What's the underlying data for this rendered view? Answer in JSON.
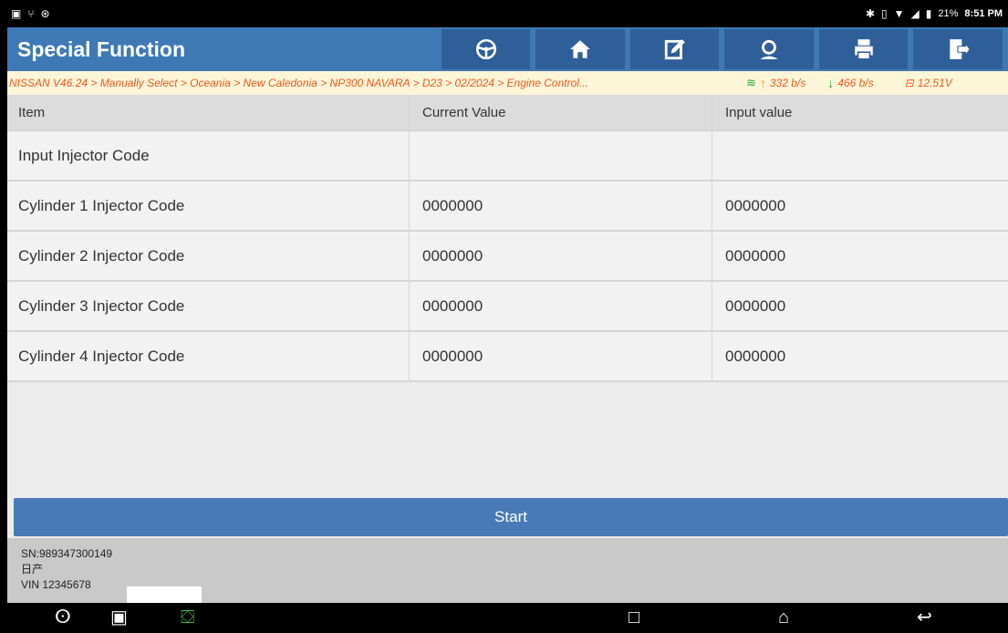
{
  "status_bar": {
    "battery_percent": "21%",
    "time": "8:51 PM"
  },
  "header": {
    "title": "Special Function",
    "buttons": [
      {
        "icon": "steering-wheel-icon"
      },
      {
        "icon": "home-icon"
      },
      {
        "icon": "edit-report-icon"
      },
      {
        "icon": "user-support-icon"
      },
      {
        "icon": "printer-icon"
      },
      {
        "icon": "exit-icon"
      }
    ]
  },
  "breadcrumb": {
    "path": "NISSAN V46.24 > Manually Select > Oceania > New Caledonia > NP300 NAVARA > D23 > 02/2024 > Engine Control...",
    "upload_speed": "332 b/s",
    "download_speed": "466 b/s",
    "voltage": "12.51V"
  },
  "table": {
    "headers": [
      "Item",
      "Current Value",
      "Input value"
    ],
    "rows": [
      {
        "item": "Input Injector Code",
        "current": "",
        "input": ""
      },
      {
        "item": "Cylinder 1 Injector Code",
        "current": "0000000",
        "input": "0000000"
      },
      {
        "item": "Cylinder 2 Injector Code",
        "current": "0000000",
        "input": "0000000"
      },
      {
        "item": "Cylinder 3 Injector Code",
        "current": "0000000",
        "input": "0000000"
      },
      {
        "item": "Cylinder 4 Injector Code",
        "current": "0000000",
        "input": "0000000"
      }
    ]
  },
  "start_button": "Start",
  "info": {
    "sn": "SN:989347300149",
    "brand": "日产",
    "vin": "VIN 12345678"
  },
  "colors": {
    "header_bg": "#3f79b5",
    "header_button_bg": "#2f5f99",
    "breadcrumb_text": "#f0591b",
    "breadcrumb_bg": "#fdf5d8",
    "start_button_bg": "#477ab6"
  }
}
